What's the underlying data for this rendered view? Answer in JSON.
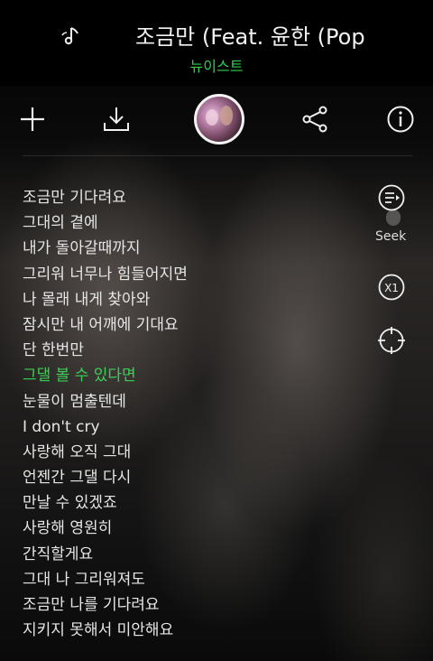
{
  "song": {
    "title": "조금만 (Feat. 윤한 (Pop",
    "artist": "뉴이스트"
  },
  "icons": {
    "note": "music-note-icon",
    "add": "plus-icon",
    "download": "download-icon",
    "album": "album-art",
    "share": "share-icon",
    "info": "info-icon",
    "seek": "lyrics-seek-icon",
    "speed": "speed-x1-icon",
    "focus": "crosshair-icon"
  },
  "side": {
    "seek_label": "Seek",
    "speed_label": "X1"
  },
  "lyrics": [
    "조금만 기다려요",
    "그대의 곁에",
    "내가 돌아갈때까지",
    "그리워 너무나 힘들어지면",
    "나 몰래 내게 찾아와",
    "잠시만 내 어깨에 기대요",
    "단 한번만",
    "그댈 볼 수 있다면",
    "눈물이 멈출텐데",
    "I don't cry",
    "사랑해 오직 그대",
    "언젠간 그댈 다시",
    "만날 수 있겠죠",
    "사랑해 영원히",
    "간직할게요",
    "그대 나 그리워져도",
    "조금만 나를 기다려요",
    "지키지 못해서 미안해요"
  ],
  "active_lyric_index": 7,
  "colors": {
    "accent": "#3ad055",
    "text": "#e6e6e6"
  }
}
